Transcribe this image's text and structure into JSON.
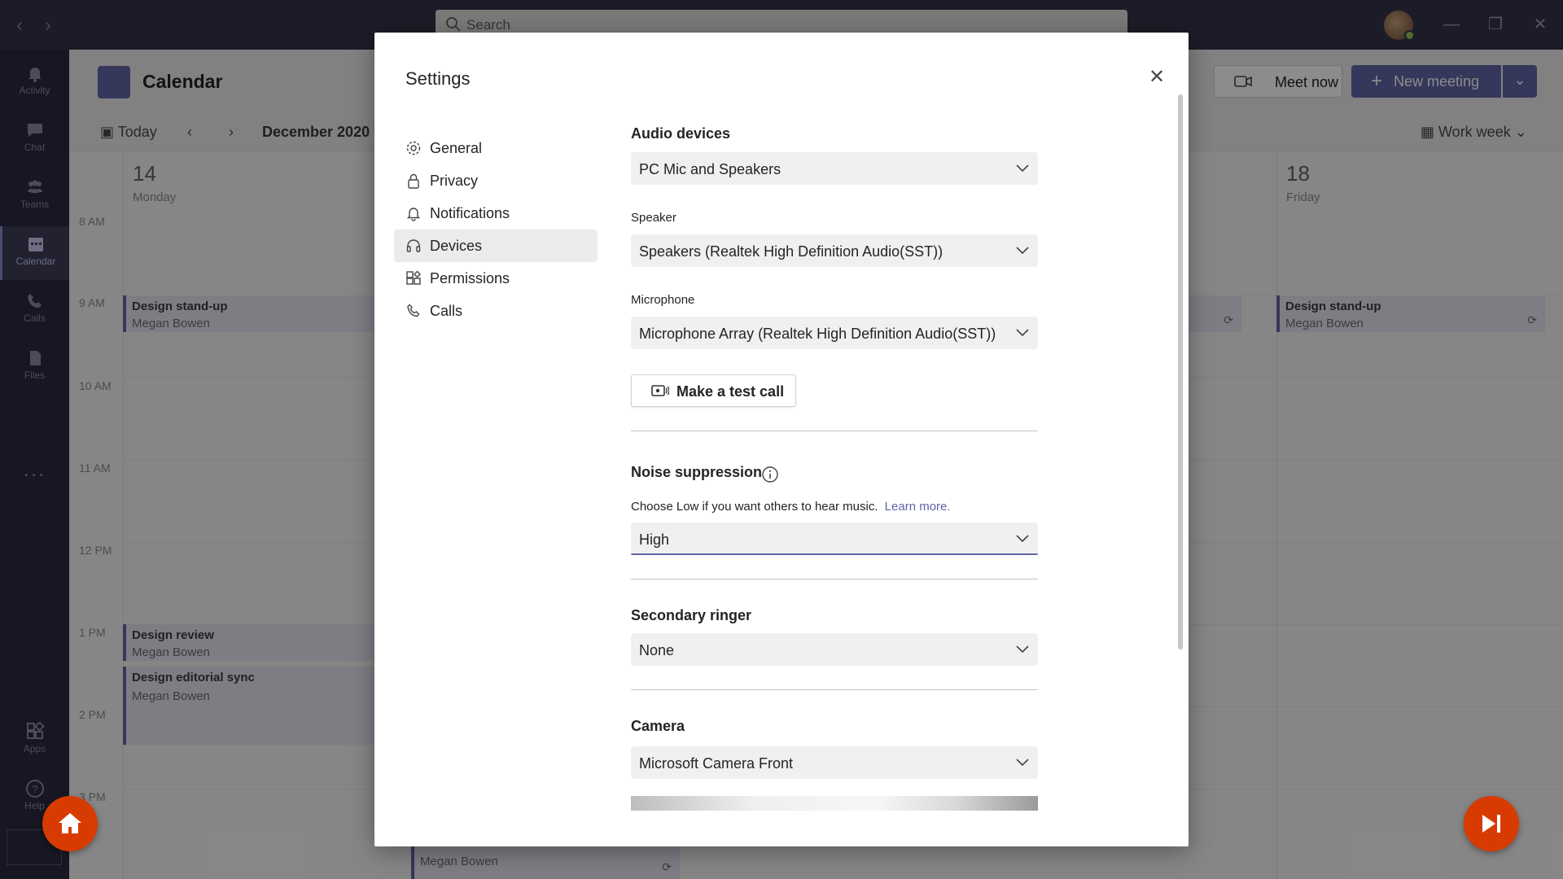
{
  "titlebar": {
    "search_placeholder": "Search"
  },
  "rail": {
    "items": [
      {
        "label": "Activity"
      },
      {
        "label": "Chat"
      },
      {
        "label": "Teams"
      },
      {
        "label": "Calendar"
      },
      {
        "label": "Calls"
      },
      {
        "label": "Files"
      },
      {
        "label": "Apps"
      },
      {
        "label": "Help"
      }
    ],
    "more": "..."
  },
  "calendar": {
    "title": "Calendar",
    "meet_now": "Meet now",
    "new_meeting": "New meeting",
    "today": "Today",
    "month": "December 2020",
    "view": "Work week",
    "days": [
      {
        "num": "14",
        "name": "Monday"
      },
      {
        "num": "18",
        "name": "Friday"
      }
    ],
    "hours": [
      "8 AM",
      "9 AM",
      "10 AM",
      "11 AM",
      "12 PM",
      "1 PM",
      "2 PM",
      "3 PM"
    ],
    "events": [
      {
        "title": "Design stand-up",
        "organizer": "Megan Bowen"
      },
      {
        "title": "Design review",
        "organizer": "Megan Bowen"
      },
      {
        "title": "Design editorial sync",
        "organizer": "Megan Bowen"
      },
      {
        "title": "Design stand-up",
        "organizer": "Megan Bowen"
      },
      {
        "title": "",
        "organizer": "Megan Bowen"
      }
    ]
  },
  "settings": {
    "title": "Settings",
    "nav": [
      {
        "label": "General",
        "icon": "gear-icon"
      },
      {
        "label": "Privacy",
        "icon": "lock-icon"
      },
      {
        "label": "Notifications",
        "icon": "bell-icon"
      },
      {
        "label": "Devices",
        "icon": "headset-icon",
        "active": true
      },
      {
        "label": "Permissions",
        "icon": "permissions-icon"
      },
      {
        "label": "Calls",
        "icon": "phone-icon"
      }
    ],
    "audio_devices": {
      "title": "Audio devices",
      "value": "PC Mic and Speakers"
    },
    "speaker": {
      "label": "Speaker",
      "value": "Speakers (Realtek High Definition Audio(SST))"
    },
    "microphone": {
      "label": "Microphone",
      "value": "Microphone Array (Realtek High Definition Audio(SST))"
    },
    "test_call": "Make a test call",
    "noise_suppression": {
      "title": "Noise suppression",
      "helper": "Choose Low if you want others to hear music.",
      "learn_more": "Learn more.",
      "value": "High"
    },
    "secondary_ringer": {
      "title": "Secondary ringer",
      "value": "None"
    },
    "camera": {
      "title": "Camera",
      "value": "Microsoft Camera Front"
    }
  },
  "colors": {
    "accent": "#6264a7",
    "fab": "#d83b01",
    "titlebar": "#33344a",
    "rail": "#2b2b40"
  }
}
